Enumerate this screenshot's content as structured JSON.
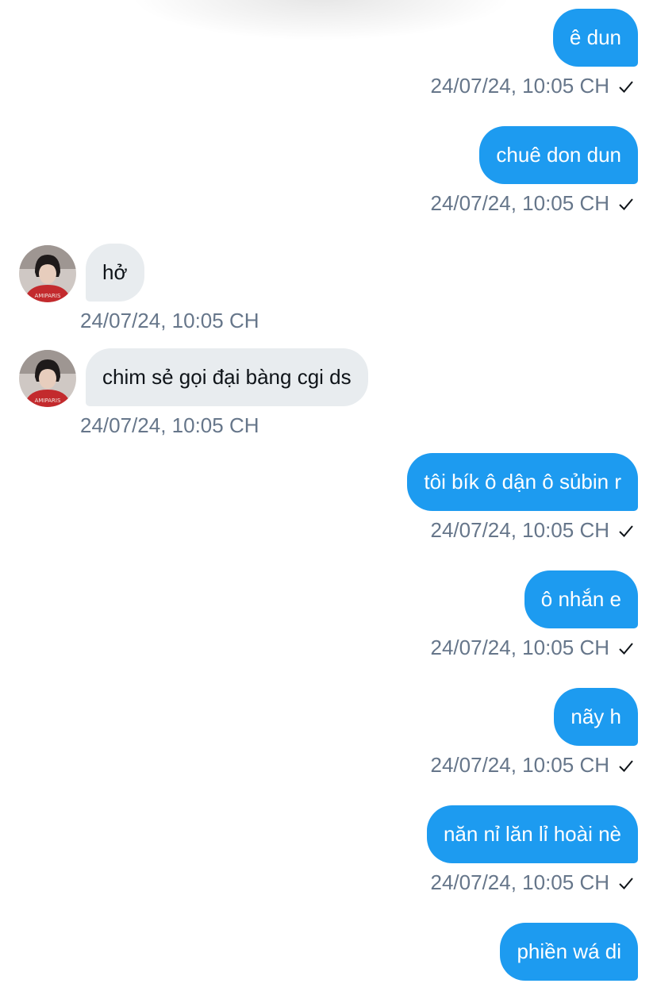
{
  "colors": {
    "outgoing_bubble": "#1d9bf0",
    "incoming_bubble": "#e8ecef",
    "timestamp": "#66768a"
  },
  "messages": [
    {
      "direction": "out",
      "text": "ê dun",
      "time": "24/07/24, 10:05 CH",
      "status_icon": "check-icon"
    },
    {
      "direction": "out",
      "text": "chuê don dun",
      "time": "24/07/24, 10:05 CH",
      "status_icon": "check-icon"
    },
    {
      "direction": "in",
      "text": "hở",
      "time": "24/07/24, 10:05 CH",
      "avatar": "avatar-icon"
    },
    {
      "direction": "in",
      "text": "chim sẻ gọi đại bàng cgi ds",
      "time": "24/07/24, 10:05 CH",
      "avatar": "avatar-icon"
    },
    {
      "direction": "out",
      "text": "tôi bík ô dận ô sủbin r",
      "time": "24/07/24, 10:05 CH",
      "status_icon": "check-icon"
    },
    {
      "direction": "out",
      "text": "ô nhắn e",
      "time": "24/07/24, 10:05 CH",
      "status_icon": "check-icon"
    },
    {
      "direction": "out",
      "text": "nãy h",
      "time": "24/07/24, 10:05 CH",
      "status_icon": "check-icon"
    },
    {
      "direction": "out",
      "text": "năn nỉ lăn lỉ hoài nè",
      "time": "24/07/24, 10:05 CH",
      "status_icon": "check-icon"
    },
    {
      "direction": "out",
      "text": "phiền wá di"
    }
  ]
}
